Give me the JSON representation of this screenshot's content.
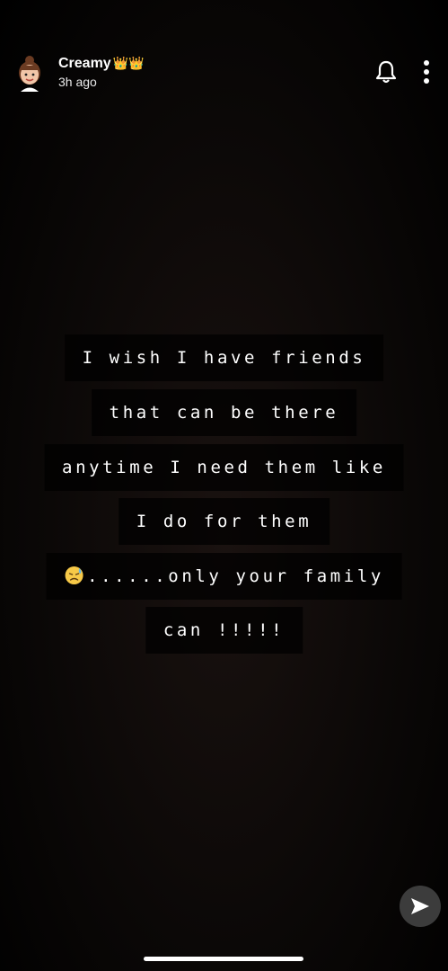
{
  "header": {
    "user_name": "Creamy",
    "crowns": "👑👑",
    "time_ago": "3h ago"
  },
  "caption": {
    "lines": [
      "I wish I have friends",
      "that can be there",
      "anytime I need them like",
      "I do for them",
      "......only your family",
      "can !!!!!"
    ],
    "emoji": "downcast-face-with-sweat"
  },
  "icons": {
    "bell": "bell-icon",
    "more": "more-vertical-icon",
    "send": "send-arrow-icon"
  },
  "colors": {
    "background": "#000000",
    "text": "#ffffff",
    "caption_bg": "#000000b8",
    "send_button": "#3c3c3c"
  }
}
